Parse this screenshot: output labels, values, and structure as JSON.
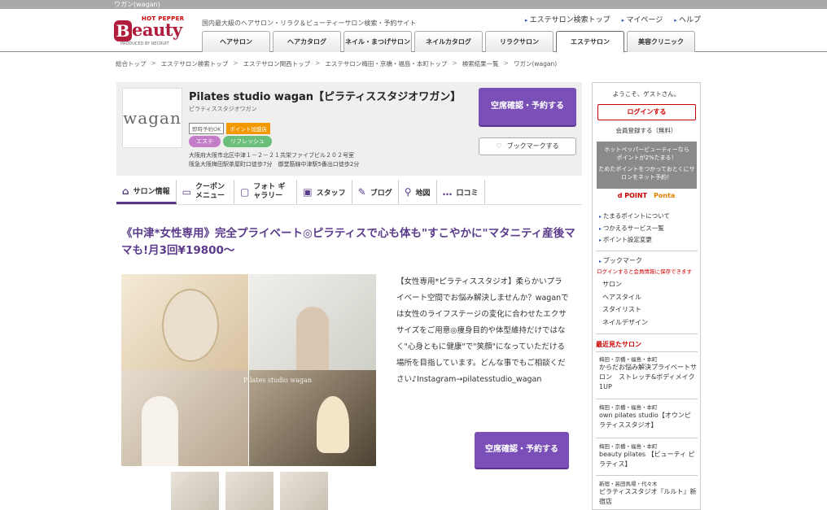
{
  "browser": {
    "title": "ワガン(wagan)"
  },
  "header": {
    "logo_top": "HOT PEPPER",
    "logo_letter": "B",
    "logo_word": "eauty",
    "logo_sub": "PRODUCED BY RECRUIT",
    "tagline": "国内最大級のヘアサロン・リラク＆ビューティーサロン検索・予約サイト",
    "links": [
      "エステサロン検索トップ",
      "マイページ",
      "ヘルプ"
    ],
    "tabs": [
      "ヘアサロン",
      "ヘアカタログ",
      "ネイル・まつげサロン",
      "ネイルカタログ",
      "リラクサロン",
      "エステサロン",
      "美容クリニック"
    ]
  },
  "breadcrumb": [
    "総合トップ",
    "エステサロン検索トップ",
    "エステサロン関西トップ",
    "エステサロン梅田・京橋・福島・本町トップ",
    "検索結果一覧",
    "ワガン(wagan)"
  ],
  "salon": {
    "logo_text": "wagan",
    "name": "Pilates studio wagan【ピラティススタジオワガン】",
    "kana": "ピラティススタジオワガン",
    "tag_instant": "即時予約OK",
    "tag_points": "ポイント加盟店",
    "genre1": "エステ",
    "genre2": "リフレッシュ",
    "address": "大阪府大阪市北区中津１－２－２１共栄ファイブビル２０２号室",
    "access": "阪急大阪梅田駅茶屋町口徒歩7分　御堂筋線中津駅5番出口徒歩2分",
    "book_label": "空席確認・予約する",
    "bookmark_label": "ブックマークする"
  },
  "nav": {
    "items": [
      {
        "icon": "⌂",
        "label": "サロン情報"
      },
      {
        "icon": "▭",
        "label": "クーポン メニュー"
      },
      {
        "icon": "▢",
        "label": "フォト ギャラリー"
      },
      {
        "icon": "▣",
        "label": "スタッフ"
      },
      {
        "icon": "✎",
        "label": "ブログ"
      },
      {
        "icon": "⚲",
        "label": "地図"
      },
      {
        "icon": "…",
        "label": "口コミ"
      }
    ]
  },
  "main": {
    "headline": "《中津*女性専用》完全プライベート◎ピラティスで心も体も\"すこやかに\"マタニティ産後ママも!月3回¥19800～",
    "photo_caption": "Pilates studio wagan",
    "description": "【女性専用*ピラティススタジオ】柔らかいプライベート空間でお悩み解決しませんか？waganでは女性のライフステージの変化に合わせたエクササイズをご用意◎痩身目的や体型維持だけではなく\"心身ともに健康\"で\"笑顔\"になっていただける場所を目指しています。どんな事でもご相談ください♪Instagram→pilatesstudio_wagan",
    "book_label": "空席確認・予約する"
  },
  "sidebar": {
    "welcome": "ようこそ、ゲストさん。",
    "login": "ログインする",
    "register": "会員登録する（無料）",
    "point_line1": "ホットペッパービューティーなら",
    "point_line2": "ポイントが2%たまる！",
    "point_line3": "ためたポイントをつかっておとくにサロンをネット予約！",
    "dpoint": "d POINT",
    "ponta": "Ponta",
    "point_links": [
      "たまるポイントについて",
      "つかえるサービス一覧",
      "ポイント設定変更"
    ],
    "bookmark_head": "ブックマーク",
    "bookmark_note": "ログインすると会員情報に保存できます",
    "bookmark_links": [
      "サロン",
      "ヘアスタイル",
      "スタイリスト",
      "ネイルデザイン"
    ],
    "recent_head": "最近見たサロン",
    "recent": [
      {
        "area": "梅田・京橋・福島・本町",
        "name": "からだお悩み解決プライベートサロン　ストレッチ&ボディメイク1UP"
      },
      {
        "area": "梅田・京橋・福島・本町",
        "name": "own pilates studio【オウンピラティススタジオ】"
      },
      {
        "area": "梅田・京橋・福島・本町",
        "name": "beauty pilates 【ビューティ ピラティス】"
      },
      {
        "area": "新宿・高田馬場・代々木",
        "name": "ピラティススタジオ『ルルト』新宿店"
      }
    ]
  }
}
